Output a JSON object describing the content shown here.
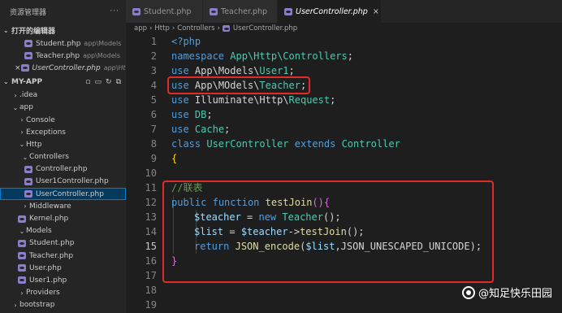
{
  "sidebar": {
    "title": "资源管理器",
    "more": "···",
    "open_editors": {
      "label": "打开的编辑器",
      "items": [
        {
          "name": "Student.php",
          "path": "app\\Models"
        },
        {
          "name": "Teacher.php",
          "path": "app\\Models"
        },
        {
          "name": "UserController.php",
          "path": "app\\Htt..."
        }
      ]
    },
    "project": {
      "label": "MY-APP",
      "tree": [
        {
          "label": ".idea",
          "chev": "›"
        },
        {
          "label": "app",
          "chev": "⌄"
        },
        {
          "label": "Console",
          "chev": "›"
        },
        {
          "label": "Exceptions",
          "chev": "›"
        },
        {
          "label": "Http",
          "chev": "⌄"
        },
        {
          "label": "Controllers",
          "chev": "⌄"
        },
        {
          "label": "Controller.php"
        },
        {
          "label": "User1Controller.php"
        },
        {
          "label": "UserController.php"
        },
        {
          "label": "Middleware",
          "chev": "›"
        },
        {
          "label": "Kernel.php"
        },
        {
          "label": "Models",
          "chev": "⌄"
        },
        {
          "label": "Student.php"
        },
        {
          "label": "Teacher.php"
        },
        {
          "label": "User.php"
        },
        {
          "label": "User1.php"
        },
        {
          "label": "Providers",
          "chev": "›"
        },
        {
          "label": "bootstrap",
          "chev": "›"
        },
        {
          "label": "config",
          "chev": "›"
        }
      ]
    }
  },
  "tabs": [
    {
      "label": "Student.php"
    },
    {
      "label": "Teacher.php"
    },
    {
      "label": "UserController.php",
      "close": "×"
    }
  ],
  "breadcrumb": [
    "app",
    "Http",
    "Controllers",
    "UserController.php"
  ],
  "code": {
    "line_numbers": [
      "1",
      "2",
      "3",
      "4",
      "5",
      "6",
      "7",
      "8",
      "9",
      "10",
      "11",
      "12",
      "13",
      "14",
      "15",
      "16",
      "17",
      "18",
      "19"
    ],
    "line1": [
      "<?php"
    ],
    "line2": [
      "namespace",
      " ",
      "App\\Http\\Controllers",
      ";"
    ],
    "line3": [
      "use",
      " ",
      "App\\Models\\",
      "User1",
      ";"
    ],
    "line4": [
      "use",
      " ",
      "App\\MOdels\\",
      "Teacher",
      ";"
    ],
    "line5": [
      "use",
      " ",
      "Illuminate\\Http\\",
      "Request",
      ";"
    ],
    "line6": [
      "use",
      " ",
      "DB",
      ";"
    ],
    "line7": [
      "use",
      " ",
      "Cache",
      ";"
    ],
    "line8": [
      "class",
      " ",
      "UserController",
      " ",
      "extends",
      " ",
      "Controller"
    ],
    "line9": [
      "{"
    ],
    "line11": [
      "//联表"
    ],
    "line12": [
      "public",
      " ",
      "function",
      " ",
      "testJoin",
      "(){"
    ],
    "line13": [
      "$teacher",
      " = ",
      "new",
      " ",
      "Teacher",
      "();"
    ],
    "line14": [
      "$list",
      " = ",
      "$teacher",
      "->",
      "testJoin",
      "();"
    ],
    "line15": [
      "return",
      " ",
      "JSON_encode",
      "(",
      "$list",
      ",JSON_UNESCAPED_UNICODE);"
    ],
    "line16": [
      "}"
    ]
  },
  "watermark": "@知足快乐田园",
  "colors": {
    "highlight_box": "#e02b2b",
    "selection": "#04395e",
    "accent": "#007fd4"
  }
}
